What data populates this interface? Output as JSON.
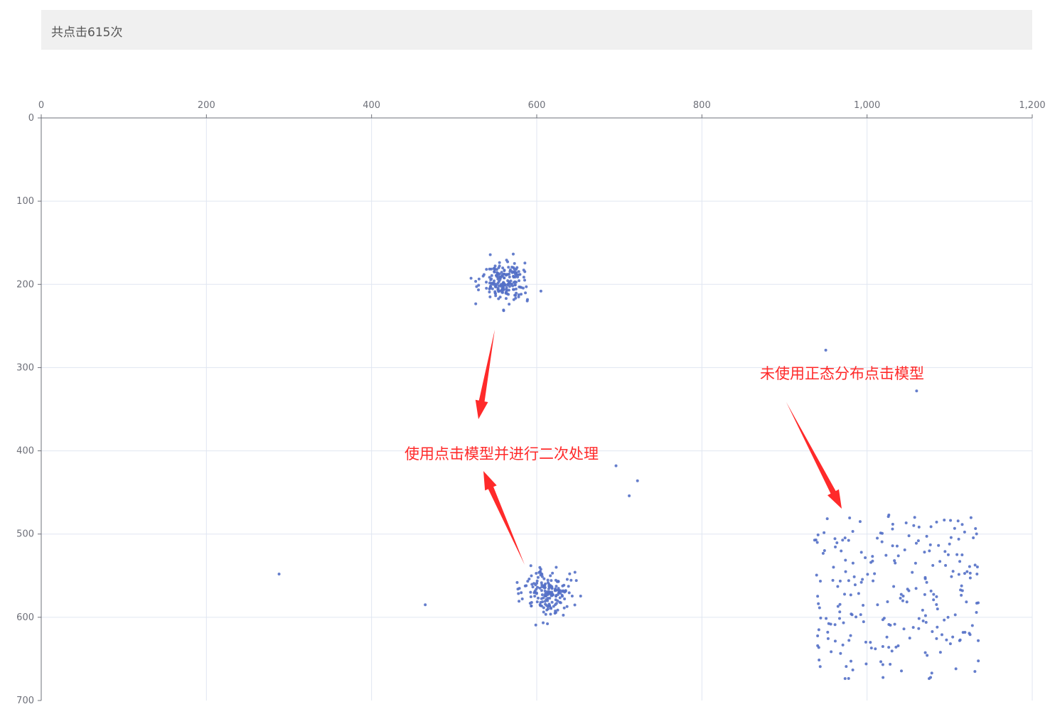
{
  "header": {
    "text": "共点击615次"
  },
  "chart_data": {
    "type": "scatter",
    "xlim": [
      0,
      1200
    ],
    "ylim": [
      0,
      700
    ],
    "x_axis_position": "top",
    "y_axis_inverted": true,
    "grid": true,
    "x_ticks": [
      "0",
      "200",
      "400",
      "600",
      "800",
      "1,000",
      "1,200"
    ],
    "y_ticks": [
      "0",
      "100",
      "200",
      "300",
      "400",
      "500",
      "600",
      "700"
    ],
    "point_color": "#5470c6",
    "clusters": [
      {
        "name": "cluster-top",
        "distribution": "normal",
        "center": [
          560,
          198
        ],
        "spread": [
          14,
          13
        ],
        "count": 200
      },
      {
        "name": "cluster-bottom",
        "distribution": "normal",
        "center": [
          615,
          570
        ],
        "spread": [
          15,
          14
        ],
        "count": 180
      },
      {
        "name": "cluster-right",
        "distribution": "uniform",
        "x_range": [
          935,
          1135
        ],
        "y_range": [
          477,
          675
        ],
        "count": 230
      }
    ],
    "outliers": [
      [
        288,
        548
      ],
      [
        465,
        585
      ],
      [
        696,
        418
      ],
      [
        712,
        454
      ],
      [
        722,
        436
      ],
      [
        950,
        279
      ],
      [
        1060,
        328
      ]
    ],
    "annotations": [
      {
        "text": "使用点击模型并进行二次处理",
        "color": "#ff2a2a"
      },
      {
        "text": "未使用正态分布点击模型",
        "color": "#ff2a2a"
      }
    ]
  }
}
